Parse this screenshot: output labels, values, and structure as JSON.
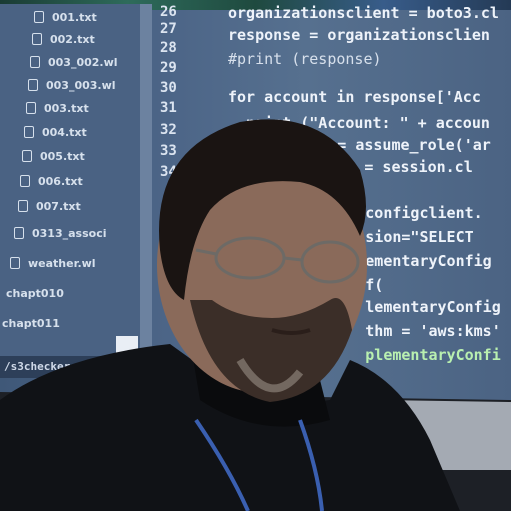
{
  "sidebar": {
    "files": [
      "001.txt",
      "002.txt",
      "003_002.wl",
      "003_003.wl",
      "003.txt",
      "004.txt",
      "005.txt",
      "006.txt",
      "007.txt",
      "0313_associ",
      "weather.wl",
      "chapt010",
      "chapt011"
    ]
  },
  "statusbar": {
    "filename": "/s3checker.py"
  },
  "editor": {
    "line_numbers": [
      "26",
      "27",
      "28",
      "29",
      "30",
      "31",
      "32",
      "33",
      "34"
    ],
    "code_lines": [
      "organizationsclient = boto3.cl",
      "response = organizationsclien",
      "#print (response)",
      "for account in response['Acc",
      "  print (\"Account: \" + accoun",
      "         = assume_role('ar",
      "         nt = session.cl",
      "         configclient.",
      "         sion=\"SELECT",
      "         ementaryConfig",
      "         f(",
      "         lementaryConfig",
      "         thm = 'aws:kms'",
      "         plementaryConfi"
    ]
  },
  "colors": {
    "screen": "#4d6688",
    "code_text": "#eef3fa",
    "shirt": "#101216",
    "lanyard": "#3a5fb0"
  }
}
